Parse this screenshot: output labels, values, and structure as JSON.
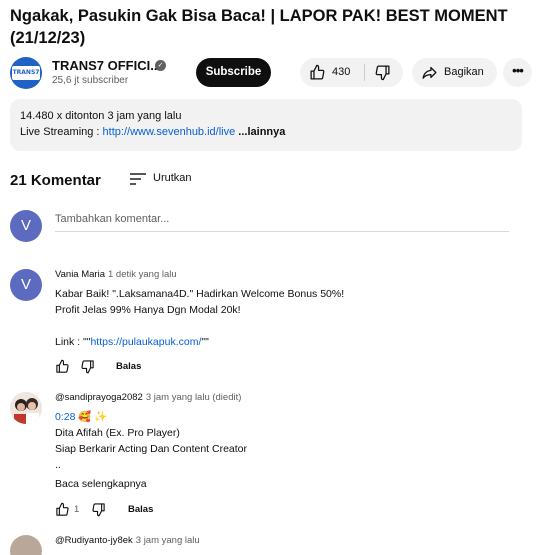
{
  "video": {
    "title_line1": "Ngakak, Pasukin Gak Bisa Baca! | LAPOR PAK! BEST MOMENT",
    "title_line2": "(21/12/23)"
  },
  "channel": {
    "logo_text": "TRANS7",
    "name": "TRANS7 OFFICI...",
    "subscribers": "25,6 jt subscriber",
    "subscribe_label": "Subscribe"
  },
  "actions": {
    "like_count": "430",
    "share_label": "Bagikan",
    "more_label": "•••"
  },
  "description": {
    "stats": "14.480 x ditonton  3 jam yang lalu",
    "line_prefix": "Live Streaming : ",
    "line_link": "http://www.sevenhub.id/live",
    "line_suffix": " ...lainnya"
  },
  "comments_header": {
    "count_label": "21 Komentar",
    "sort_label": "Urutkan"
  },
  "add_comment": {
    "avatar_letter": "V",
    "placeholder": "Tambahkan komentar..."
  },
  "comments": [
    {
      "avatar_letter": "V",
      "author": "Vania Maria",
      "time": "1 detik yang lalu",
      "line1": "Kabar Baik! \".Laksamana4D.\" Hadirkan Welcome Bonus 50%!",
      "line2": "Profit Jelas 99% Hanya Dgn Modal 20k!",
      "link_prefix": "Link  : \"\"",
      "link_text": "https://pulaukapuk.com/",
      "link_suffix": "\"\"",
      "reply_label": "Balas"
    },
    {
      "author": "@sandiprayoga2082",
      "time": "3 jam yang lalu (diedit)",
      "timestamp_link": "0:28",
      "emoji": "🥰 ✨",
      "line1": "Dita Afifah (Ex. Pro Player)",
      "line2": "Siap Berkarir Acting Dan Content Creator",
      "line3": "..",
      "read_more": "Baca selengkapnya",
      "like_count": "1",
      "reply_label": "Balas"
    },
    {
      "author": "@Rudiyanto-jy8ek",
      "time": "3 jam yang lalu"
    }
  ],
  "colors": {
    "link": "#065fd4",
    "subscribe_bg": "#0f0f0f",
    "pill_bg": "#f2f2f2",
    "avatar_v": "#5c6bc0"
  }
}
